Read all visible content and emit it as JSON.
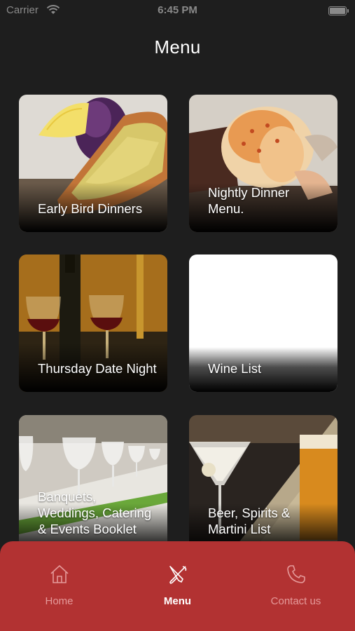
{
  "status_bar": {
    "carrier": "Carrier",
    "time": "6:45 PM"
  },
  "header": {
    "title": "Menu"
  },
  "menu_items": [
    {
      "label": "Early Bird Dinners"
    },
    {
      "label": "Nightly Dinner Menu."
    },
    {
      "label": "Thursday Date Night"
    },
    {
      "label": "Wine List"
    },
    {
      "label": "Banquets, Weddings, Catering & Events Booklet"
    },
    {
      "label": "Beer, Spirits & Martini List"
    }
  ],
  "tabbar": {
    "tabs": [
      {
        "label": "Home",
        "icon": "home-icon"
      },
      {
        "label": "Menu",
        "icon": "fork-knife-icon",
        "active": true
      },
      {
        "label": "Contact us",
        "icon": "phone-icon"
      }
    ]
  },
  "colors": {
    "background": "#1e1e1e",
    "tabbar": "#b23232",
    "tab_inactive": "#e59a9a"
  }
}
